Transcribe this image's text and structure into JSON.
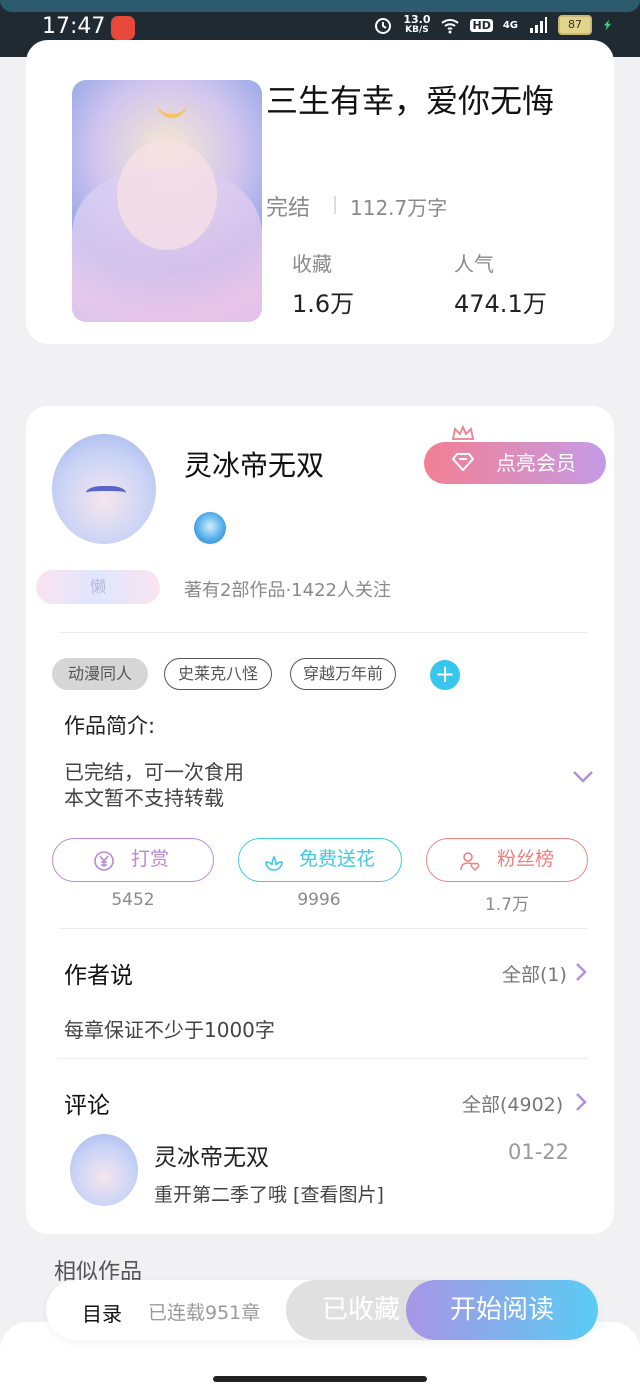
{
  "status_bar": {
    "time": "17:47",
    "net_rate_value": "13.0",
    "net_rate_unit": "KB/S",
    "hd": "HD",
    "network": "4G",
    "battery": "87"
  },
  "book": {
    "title": "三生有幸，爱你无悔",
    "status": "完结",
    "words": "112.7万字",
    "collect_label": "收藏",
    "collect_value": "1.6万",
    "popularity_label": "人气",
    "popularity_value": "474.1万"
  },
  "author": {
    "name": "灵冰帝无双",
    "badge": "懒",
    "meta": "著有2部作品·1422人关注",
    "vip_label": "点亮会员"
  },
  "tags": [
    "动漫同人",
    "史莱克八怪",
    "穿越万年前"
  ],
  "tag_add": "+",
  "intro": {
    "title": "作品简介:",
    "lines": [
      "已完结，可一次食用",
      "本文暂不支持转载"
    ]
  },
  "actions": [
    {
      "label": "打赏",
      "count": "5452",
      "color": "#b98ad7"
    },
    {
      "label": "免费送花",
      "count": "9996",
      "color": "#3ecbe4"
    },
    {
      "label": "粉丝榜",
      "count": "1.7万",
      "color": "#f07f7f"
    }
  ],
  "author_says": {
    "title": "作者说",
    "all": "全部(1)",
    "text": "每章保证不少于1000字"
  },
  "comments": {
    "title": "评论",
    "all": "全部(4902)",
    "items": [
      {
        "name": "灵冰帝无双",
        "date": "01-22",
        "text": "重开第二季了哦 [查看图片]"
      }
    ]
  },
  "similar_title": "相似作品",
  "bottom_bar": {
    "catalog": "目录",
    "serial": "已连载951章",
    "collected": "已收藏",
    "read": "开始阅读"
  }
}
